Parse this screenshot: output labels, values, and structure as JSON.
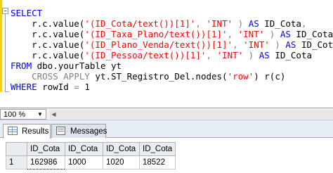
{
  "editor": {
    "collapse_glyph": "−",
    "lines": [
      [
        {
          "t": "SELECT",
          "c": "kw"
        }
      ],
      [
        {
          "t": "    r.c.value(",
          "c": "plain"
        },
        {
          "t": "'(ID_Cota/text())[1]'",
          "c": "str"
        },
        {
          "t": ", ",
          "c": "gray"
        },
        {
          "t": "'INT'",
          "c": "str"
        },
        {
          "t": " ) ",
          "c": "gray"
        },
        {
          "t": "AS",
          "c": "kw"
        },
        {
          "t": " ID_Cota",
          "c": "plain"
        },
        {
          "t": ",",
          "c": "gray"
        }
      ],
      [
        {
          "t": "    r.c.value(",
          "c": "plain"
        },
        {
          "t": "'(ID_Taxa_Plano/text())[1]'",
          "c": "str"
        },
        {
          "t": ", ",
          "c": "gray"
        },
        {
          "t": "'INT'",
          "c": "str"
        },
        {
          "t": " ) ",
          "c": "gray"
        },
        {
          "t": "AS",
          "c": "kw"
        },
        {
          "t": " ID_Cota",
          "c": "plain"
        },
        {
          "t": ",",
          "c": "gray"
        }
      ],
      [
        {
          "t": "    r.c.value(",
          "c": "plain"
        },
        {
          "t": "'(ID_Plano_Venda/text())[1]'",
          "c": "str"
        },
        {
          "t": ", ",
          "c": "gray"
        },
        {
          "t": "'INT'",
          "c": "str"
        },
        {
          "t": " ) ",
          "c": "gray"
        },
        {
          "t": "AS",
          "c": "kw"
        },
        {
          "t": " ID_Cota",
          "c": "plain"
        },
        {
          "t": ",",
          "c": "gray"
        }
      ],
      [
        {
          "t": "    r.c.value(",
          "c": "plain"
        },
        {
          "t": "'(ID_Pessoa/text())[1]'",
          "c": "str"
        },
        {
          "t": ", ",
          "c": "gray"
        },
        {
          "t": "'INT'",
          "c": "str"
        },
        {
          "t": " ) ",
          "c": "gray"
        },
        {
          "t": "AS",
          "c": "kw"
        },
        {
          "t": " ID_Cota",
          "c": "plain"
        }
      ],
      [
        {
          "t": "FROM",
          "c": "kw"
        },
        {
          "t": " dbo.yourTable yt",
          "c": "plain"
        }
      ],
      [
        {
          "t": "    ",
          "c": "plain"
        },
        {
          "t": "CROSS APPLY",
          "c": "gray"
        },
        {
          "t": " yt.ST_Registro_Del.nodes(",
          "c": "plain"
        },
        {
          "t": "'row'",
          "c": "str"
        },
        {
          "t": ") r(c)",
          "c": "plain"
        }
      ],
      [
        {
          "t": "WHERE",
          "c": "kw"
        },
        {
          "t": " rowId ",
          "c": "plain"
        },
        {
          "t": "=",
          "c": "gray"
        },
        {
          "t": " 1",
          "c": "plain"
        }
      ]
    ],
    "colors": {
      "keyword": "#0000ff",
      "string": "#ff0000",
      "operator": "#808080",
      "margin": "#f0d21c"
    }
  },
  "zoom": {
    "value": "100 %",
    "arrow_icon": "chevron-down-icon",
    "scroll_left_icon": "chevron-left-icon"
  },
  "tabs": {
    "results": {
      "label": "Results",
      "icon": "grid-icon"
    },
    "messages": {
      "label": "Messages",
      "icon": "messages-icon"
    }
  },
  "grid": {
    "columns": [
      "ID_Cota",
      "ID_Cota",
      "ID_Cota",
      "ID_Cota"
    ],
    "rows": [
      {
        "num": "1",
        "cells": [
          "162986",
          "1000",
          "1020",
          "18522"
        ]
      }
    ]
  }
}
